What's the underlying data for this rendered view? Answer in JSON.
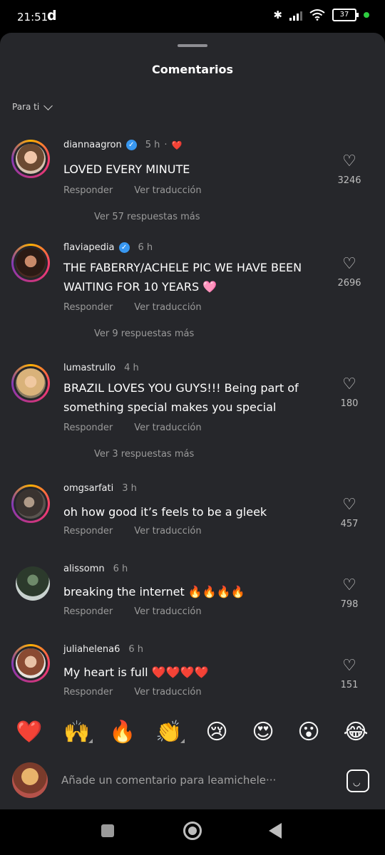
{
  "status_bar": {
    "time": "21:51",
    "app_letter": "d",
    "battery": "37"
  },
  "sheet": {
    "title": "Comentarios",
    "sort_label": "Para ti"
  },
  "comments": [
    {
      "username": "diannaagron",
      "verified": true,
      "time": "5 h",
      "reaction_marker": "❤️",
      "text": "LOVED EVERY MINUTE",
      "reply": "Responder",
      "translate": "Ver traducción",
      "more": "Ver 57 respuestas más",
      "likes": "3246"
    },
    {
      "username": "flaviapedia",
      "verified": true,
      "time": "6 h",
      "text": "THE FABERRY/ACHELE PIC WE HAVE BEEN WAITING FOR 10 YEARS 🩷",
      "reply": "Responder",
      "translate": "Ver traducción",
      "more": "Ver 9 respuestas más",
      "likes": "2696"
    },
    {
      "username": "lumastrullo",
      "verified": false,
      "time": "4 h",
      "text": "BRAZIL LOVES YOU GUYS!!! Being part of something special makes you special",
      "reply": "Responder",
      "translate": "Ver traducción",
      "more": "Ver 3 respuestas más",
      "likes": "180"
    },
    {
      "username": "omgsarfati",
      "verified": false,
      "time": "3 h",
      "text": "oh how good it’s feels to be a gleek",
      "reply": "Responder",
      "translate": "Ver traducción",
      "likes": "457"
    },
    {
      "username": "alissomn",
      "verified": false,
      "time": "6 h",
      "text": "breaking the internet 🔥🔥🔥🔥",
      "reply": "Responder",
      "translate": "Ver traducción",
      "likes": "798"
    },
    {
      "username": "juliahelena6",
      "verified": false,
      "time": "6 h",
      "text": "My heart is full ❤️❤️❤️❤️",
      "reply": "Responder",
      "translate": "Ver traducción",
      "likes": "151"
    }
  ],
  "quick_reactions": [
    "❤️",
    "🙌",
    "🔥",
    "👏",
    "😢",
    "😍",
    "😮",
    "😂"
  ],
  "composer": {
    "placeholder": "Añade un comentario para leamichele···"
  },
  "icons": {
    "like": "heart-outline-icon",
    "verified": "verified-badge-icon",
    "sticker": "sticker-icon"
  }
}
